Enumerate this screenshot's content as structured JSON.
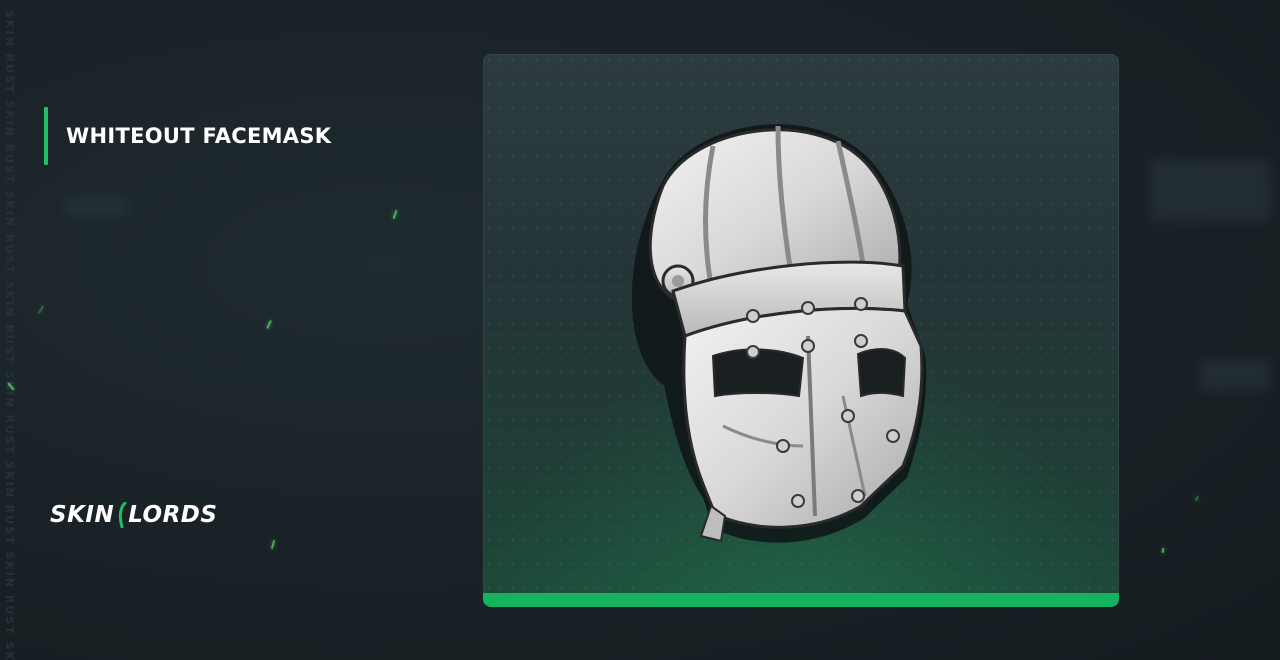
{
  "item": {
    "name": "WHITEOUT FACEMASK",
    "image_icon": "facemask-icon"
  },
  "brand": {
    "logo_left": "SKIN",
    "logo_right": "LORDS",
    "watermark": "SKIN RUST SKIN RUST SKIN RUST SKIN RUST SKIN RUST SKIN RUST SKIN RUST SKIN"
  },
  "colors": {
    "accent": "#1fbf65",
    "card_bar": "#16b35e",
    "background": "#1a2328"
  }
}
